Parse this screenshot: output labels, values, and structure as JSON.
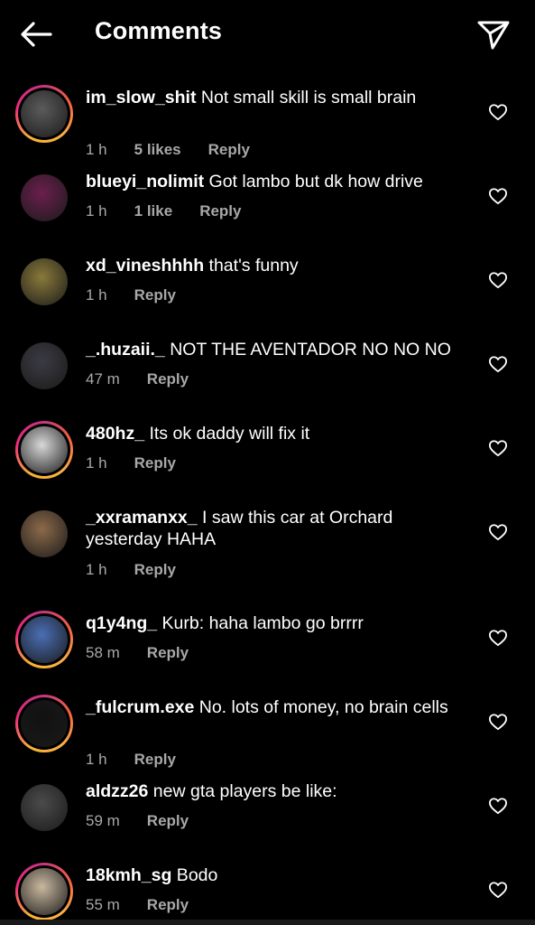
{
  "header": {
    "title": "Comments",
    "back_icon": "arrow-left-icon",
    "send_icon": "paper-plane-icon"
  },
  "comments": [
    {
      "user": "im_slow_shit",
      "text": " Not small skill is small brain",
      "time": "1 h",
      "likes": "5 likes",
      "reply": "Reply",
      "ring": true,
      "avatar_color": "#5b5b5b"
    },
    {
      "user": "blueyi_nolimit",
      "text": " Got lambo but dk how drive",
      "time": "1 h",
      "likes": "1 like",
      "reply": "Reply",
      "ring": false,
      "avatar_color": "#6b1f4e"
    },
    {
      "user": "xd_vineshhhh",
      "text": " that's funny",
      "time": "1 h",
      "likes": "",
      "reply": "Reply",
      "ring": false,
      "avatar_color": "#8a7a3a"
    },
    {
      "user": "_.huzaii._",
      "text": " NOT THE AVENTADOR NO NO NO",
      "time": "47 m",
      "likes": "",
      "reply": "Reply",
      "ring": false,
      "avatar_color": "#3b3b44"
    },
    {
      "user": "480hz_",
      "text": " Its ok daddy will fix it",
      "time": "1 h",
      "likes": "",
      "reply": "Reply",
      "ring": true,
      "avatar_color": "#d8d8d8"
    },
    {
      "user": "_xxramanxx_",
      "text": " I saw this car at Orchard yesterday HAHA",
      "time": "1 h",
      "likes": "",
      "reply": "Reply",
      "ring": false,
      "avatar_color": "#8c6a4a"
    },
    {
      "user": "q1y4ng_",
      "text": " Kurb: haha lambo go brrrr",
      "time": "58 m",
      "likes": "",
      "reply": "Reply",
      "ring": true,
      "avatar_color": "#4a6fb5"
    },
    {
      "user": "_fulcrum.exe",
      "text": " No. lots of money, no brain cells",
      "time": "1 h",
      "likes": "",
      "reply": "Reply",
      "ring": true,
      "avatar_color": "#111111"
    },
    {
      "user": "aldzz26",
      "text": " new gta players be like:",
      "time": "59 m",
      "likes": "",
      "reply": "Reply",
      "ring": false,
      "avatar_color": "#4b4b4b"
    },
    {
      "user": "18kmh_sg",
      "text": " Bodo",
      "time": "55 m",
      "likes": "",
      "reply": "Reply",
      "ring": true,
      "avatar_color": "#c9b8a0"
    }
  ]
}
